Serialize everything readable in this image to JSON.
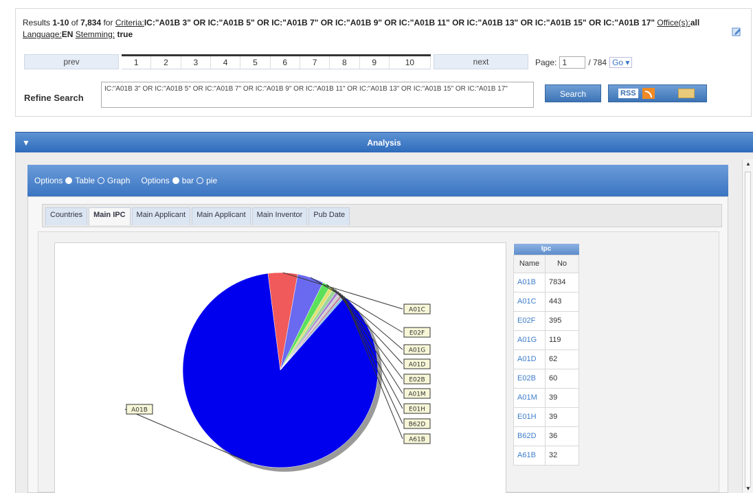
{
  "results": {
    "prefix": "Results",
    "range": "1-10",
    "of": "of",
    "total": "7,834",
    "for": "for",
    "criteria_label": "Criteria:",
    "criteria_value": "IC:\"A01B 3\" OR IC:\"A01B 5\" OR IC:\"A01B 7\" OR IC:\"A01B 9\" OR IC:\"A01B 11\" OR IC:\"A01B 13\" OR IC:\"A01B 15\" OR IC:\"A01B 17\"",
    "offices_label": "Office(s):",
    "offices_value": "all",
    "language_label": "Language:",
    "language_value": "EN",
    "stemming_label": "Stemming:",
    "stemming_value": "true",
    "edit_icon": "edit-icon"
  },
  "pager": {
    "prev": "prev",
    "next": "next",
    "pages": [
      "1",
      "2",
      "3",
      "4",
      "5",
      "6",
      "7",
      "8",
      "9",
      "10"
    ],
    "page_label": "Page:",
    "page_value": "1",
    "page_total": "/ 784",
    "go": "Go ▾"
  },
  "refine": {
    "label": "Refine Search",
    "query": "IC:\"A01B 3\" OR IC:\"A01B 5\" OR IC:\"A01B 7\" OR IC:\"A01B 9\" OR IC:\"A01B 11\" OR IC:\"A01B 13\" OR IC:\"A01B 15\" OR IC:\"A01B 17\"",
    "search_button": "Search",
    "rss_label": "RSS"
  },
  "analysis": {
    "title": "Analysis",
    "collapse_icon": "chevron-down-icon"
  },
  "options": {
    "label1": "Options",
    "table": "Table",
    "graph": "Graph",
    "label2": "Options",
    "bar": "bar",
    "pie": "pie"
  },
  "tabs": [
    {
      "label": "Countries",
      "active": false
    },
    {
      "label": "Main IPC",
      "active": true
    },
    {
      "label": "Main Applicant",
      "active": false
    },
    {
      "label": "Main Applicant",
      "active": false
    },
    {
      "label": "Main Inventor",
      "active": false
    },
    {
      "label": "Pub Date",
      "active": false
    }
  ],
  "ipc_table": {
    "caption": "Ipc",
    "col_name": "Name",
    "col_no": "No",
    "rows": [
      {
        "name": "A01B",
        "no": "7834"
      },
      {
        "name": "A01C",
        "no": "443"
      },
      {
        "name": "E02F",
        "no": "395"
      },
      {
        "name": "A01G",
        "no": "119"
      },
      {
        "name": "A01D",
        "no": "62"
      },
      {
        "name": "E02B",
        "no": "60"
      },
      {
        "name": "A01M",
        "no": "39"
      },
      {
        "name": "E01H",
        "no": "39"
      },
      {
        "name": "B62D",
        "no": "36"
      },
      {
        "name": "A61B",
        "no": "32"
      }
    ]
  },
  "chart_data": {
    "type": "pie",
    "categories": [
      "A01B",
      "A01C",
      "E02F",
      "A01G",
      "A01D",
      "E02B",
      "A01M",
      "E01H",
      "B62D",
      "A61B"
    ],
    "values": [
      7834,
      443,
      395,
      119,
      62,
      60,
      39,
      39,
      36,
      32
    ],
    "colors": [
      "#0000ee",
      "#f05a5a",
      "#6a6af0",
      "#5be05b",
      "#e0e070",
      "#9bd59b",
      "#a07ad0",
      "#d0d0d0",
      "#c08aa0",
      "#8ac8e0"
    ]
  }
}
